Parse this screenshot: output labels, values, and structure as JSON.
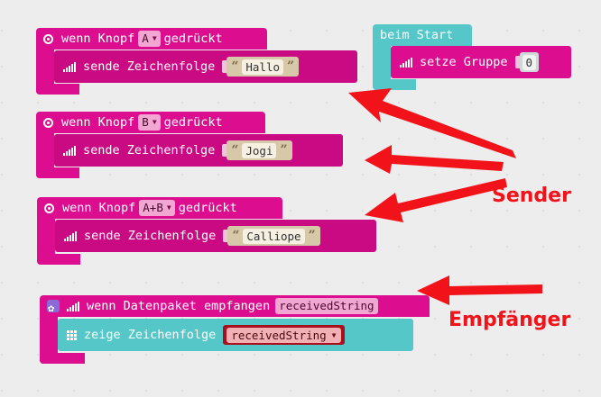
{
  "blocks": {
    "button_a": {
      "hat_prefix": "wenn Knopf",
      "button": "A",
      "hat_suffix": "gedrückt",
      "command": "sende Zeichenfolge",
      "string": "Hallo"
    },
    "button_b": {
      "hat_prefix": "wenn Knopf",
      "button": "B",
      "hat_suffix": "gedrückt",
      "command": "sende Zeichenfolge",
      "string": "Jogi"
    },
    "button_ab": {
      "hat_prefix": "wenn Knopf",
      "button": "A+B",
      "hat_suffix": "gedrückt",
      "command": "sende Zeichenfolge",
      "string": "Calliope"
    },
    "start": {
      "hat": "beim Start",
      "command": "setze Gruppe",
      "value": "0"
    },
    "receive": {
      "hat": "wenn Datenpaket empfangen",
      "param": "receivedString",
      "command": "zeige Zeichenfolge",
      "variable": "receivedString"
    }
  },
  "quotes": {
    "open": "“",
    "close": "”"
  },
  "annotations": {
    "sender": "Sender",
    "receiver": "Empfänger"
  },
  "icons": {
    "radio": "radio-icon",
    "signal": "signal-icon",
    "settings": "gear-icon",
    "led": "grid-icon",
    "dropdown": "caret-down-icon"
  },
  "colors": {
    "radio_block": "#dc0e8f",
    "basic_block": "#56c7c9",
    "string_slot": "#d6c8a9",
    "variable_block": "#a8101c",
    "annotation": "#f2121a"
  }
}
